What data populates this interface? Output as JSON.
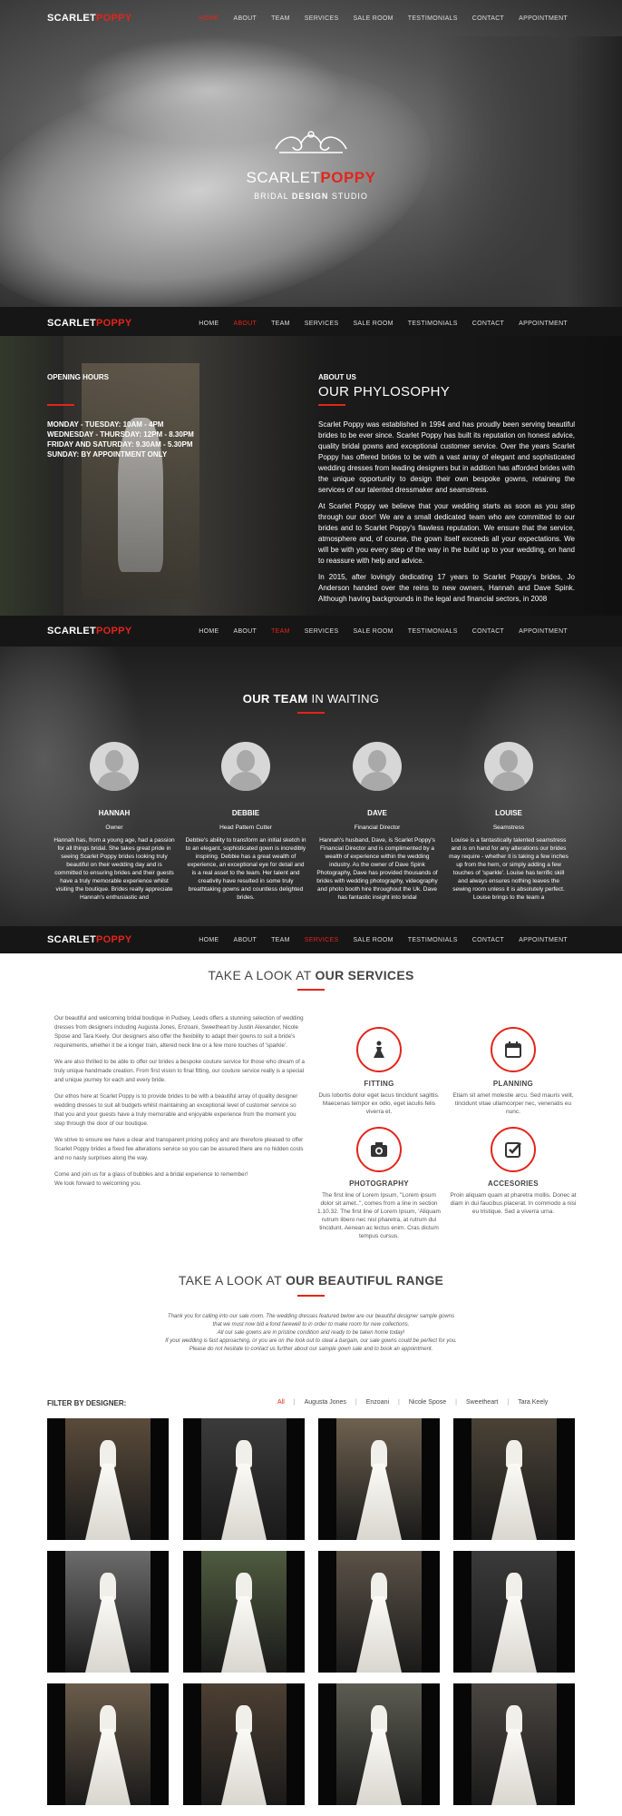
{
  "brand": {
    "scarlet": "SCARLET",
    "poppy": "POPPY",
    "tagline_a": "BRIDAL ",
    "tagline_b": "DESIGN",
    "tagline_c": " STUDIO"
  },
  "nav": {
    "items": [
      "HOME",
      "ABOUT",
      "TEAM",
      "SERVICES",
      "SALE ROOM",
      "TESTIMONIALS",
      "CONTACT",
      "APPOINTMENT"
    ]
  },
  "about": {
    "hours_title": "OPENING HOURS",
    "hours": [
      "MONDAY - TUESDAY: 10AM - 4PM",
      "WEDNESDAY - THURSDAY: 12PM - 8.30PM",
      "FRIDAY AND SATURDAY: 9.30AM - 5.30PM",
      "SUNDAY: BY APPOINTMENT ONLY"
    ],
    "subtitle": "ABOUT US",
    "title": "OUR PHYLOSOPHY",
    "paragraphs": [
      "Scarlet Poppy was established in 1994 and has proudly been serving beautiful brides to be ever since. Scarlet Poppy has built its reputation on honest advice, quality bridal gowns and exceptional customer service. Over the years Scarlet Poppy has offered brides to be with a vast array of elegant and sophisticated wedding dresses from leading designers but in addition has afforded brides with the unique opportunity to design their own bespoke gowns, retaining the services of our talented dressmaker and seamstress.",
      "At Scarlet Poppy we believe that your wedding starts as soon as you step through our door! We are a small dedicated team who are committed to our brides and to Scarlet Poppy's flawless reputation. We ensure that the service, atmosphere and, of course, the gown itself exceeds all your expectations. We will be with you every step of the way in the build up to your wedding, on hand to reassure with help and advice.",
      "In 2015, after lovingly dedicating 17 years to Scarlet Poppy's brides, Jo Anderson handed over the reins to new owners, Hannah and Dave Spink. Although having backgrounds in the legal and financial sectors, in 2008"
    ]
  },
  "team": {
    "title_a": "OUR TEAM",
    "title_b": " IN WAITING",
    "members": [
      {
        "name": "HANNAH",
        "role": "Owner",
        "text": "Hannah has, from a young age, had a passion for all things bridal. She takes great pride in seeing Scarlet Poppy brides looking truly beautiful on their wedding day and is committed to ensuring brides and their guests have a truly memorable experience whilst visiting the boutique. Brides really appreciate Hannah's enthusiastic and"
      },
      {
        "name": "DEBBIE",
        "role": "Head Pattern Cutter",
        "text": "Debbie's ability to transform an initial sketch in to an elegant, sophisticated gown is incredibly inspiring. Debbie has a great wealth of experience, an exceptional eye for detail and is a real asset to the team. Her talent and creativity have resulted in some truly breathtaking gowns and countless delighted brides."
      },
      {
        "name": "DAVE",
        "role": "Financial Director",
        "text": "Hannah's husband, Dave, is Scarlet Poppy's Financial Director and is complimented by a wealth of experience within the wedding industry. As the owner of Dave Spink Photography, Dave has provided thousands of brides with wedding photography, videography and photo booth hire throughout the Uk. Dave has fantastic insight into bridal"
      },
      {
        "name": "LOUISE",
        "role": "Seamstress",
        "text": "Louise is a fantastically talented seamstress and is on hand for any alterations our brides may require - whether it is taking a few inches up from the hem, or simply adding a few touches of 'sparkle'. Louise has terrific skill and always ensures nothing leaves the sewing room unless it is absolutely perfect. Louise brings to the team a"
      }
    ]
  },
  "services": {
    "title_a": "TAKE A LOOK AT ",
    "title_b": "OUR SERVICES",
    "paragraphs": [
      "Our beautiful and welcoming bridal boutique in Pudsey, Leeds offers a stunning selection of wedding dresses from designers including Augusta Jones, Enzoani, Sweetheart by Justin Alexander, Nicole Spose and Tara Keely. Our designers also offer the flexibility to adapt their gowns to suit a bride's requirements, whether it be a longer train, altered neck line or a few more touches of 'sparkle'.",
      "We are also thrilled to be able to offer our brides a bespoke couture service for those who dream of a truly unique handmade creation. From first vision to final fitting, our couture service really is a special and unique journey for each and every bride.",
      "Our ethos here at Scarlet Poppy is to provide brides to be with a beautiful array of quality designer wedding dresses to suit all budgets whilst maintaining an exceptional level of customer service so that you and your guests have a truly memorable and enjoyable experience from the moment you step through the door of our boutique.",
      "We strive to ensure we have a clear and transparent pricing policy and are therefore pleased to offer Scarlet Poppy brides a fixed fee alterations service so you can be assured there are no hidden costs and no nasty surprises along the way.",
      "Come and join us for a glass of bubbles and a bridal experience to remember!\nWe look forward to welcoming you."
    ],
    "items": [
      {
        "title": "FITTING",
        "icon": "dress-icon",
        "text": "Duis lobortis dolor eget lacus tincidunt sagittis. Maecenas tempor ex odio, eget iaculis felis viverra et."
      },
      {
        "title": "PLANNING",
        "icon": "calendar-icon",
        "text": "Etiam sit amet molestie arcu. Sed mauris velit, tincidunt vitae ullamcorper nec, venenatis eu nunc."
      },
      {
        "title": "PHOTOGRAPHY",
        "icon": "camera-icon",
        "text": "The first line of Lorem Ipsum, \"Lorem ipsum dolor sit amet..\", comes from a line in section 1.10.32. The first line of Lorem Ipsum, 'Aliquam rutrum libero nec nisl pharetra, at rutrum dui tincidunt. Aenean ac lectus enim. Cras dictum tempus cursus."
      },
      {
        "title": "ACCESORIES",
        "icon": "checkbox-icon",
        "text": "Proin aliquam quam at pharetra mollis. Donec at diam in dui faucibus placerat. In commodo a nisi eu tristique. Sed a viverra urna."
      }
    ]
  },
  "range": {
    "title_a": "TAKE A LOOK AT ",
    "title_b": "OUR BEAUTIFUL RANGE",
    "text": [
      "Thank you for calling into our sale room. The wedding dresses featured below are our beautiful designer sample gowns",
      "that we must now bid a fond farewell to in order to make room for new collections.",
      "All our sale gowns are in pristine condition and ready to be taken home today!",
      "If your wedding is fast approaching, or you are on the look out to steal a bargain, our sale gowns could be perfect for you.",
      "Please do not hesitate to contact us further about our sample gown sale and to book an appointment."
    ],
    "filter_label": "FILTER BY DESIGNER:",
    "filters": [
      "All",
      "Augusta Jones",
      "Enzoani",
      "Nicole Spose",
      "Sweetheart",
      "Tara Keely"
    ]
  },
  "colors": {
    "accent": "#e3251b",
    "dark": "#161616"
  }
}
